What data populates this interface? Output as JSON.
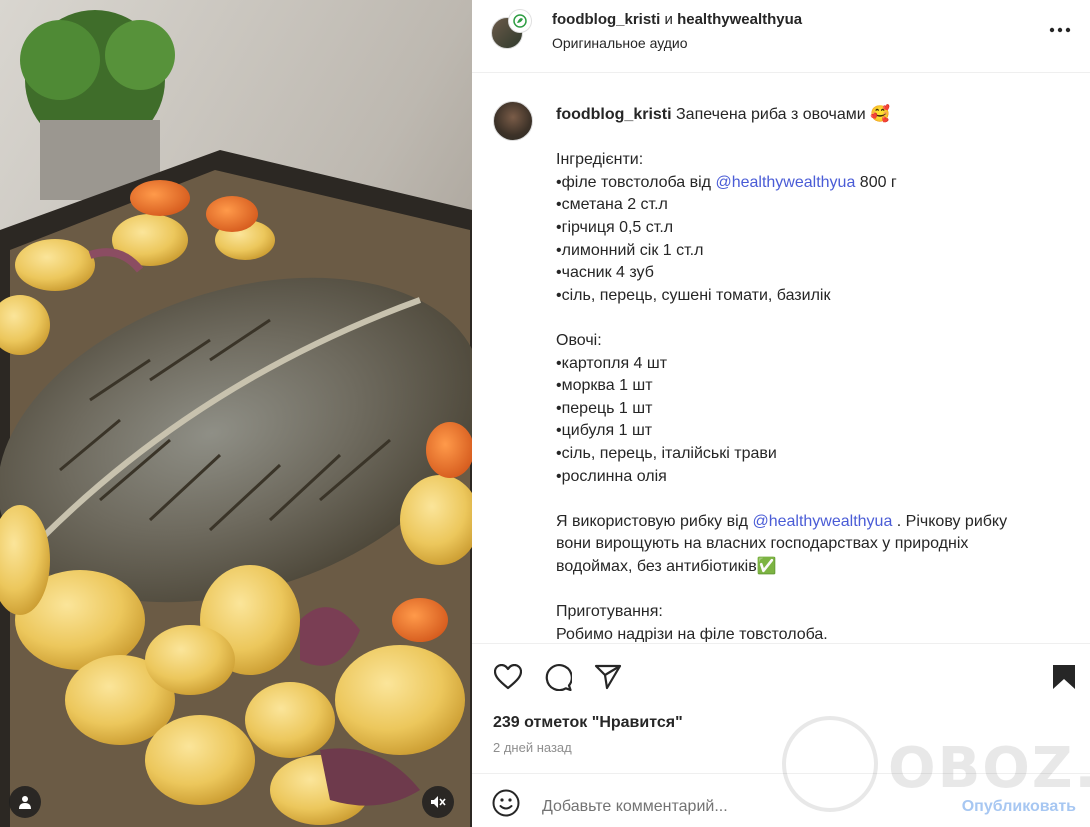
{
  "post": {
    "header": {
      "author": "foodblog_kristi",
      "conjunction": "и",
      "coauthor": "healthywealthyua",
      "audio": "Оригинальное аудио"
    },
    "caption": {
      "author": "foodblog_kristi",
      "title": "Запечена риба з овочами 🥰",
      "ingredients_heading": "Інгредієнти:",
      "ing1_prefix": "•філе товстолоба від ",
      "ing1_mention": "@healthywealthyua",
      "ing1_suffix": " 800 г",
      "ing2": "•сметана 2 ст.л",
      "ing3": "•гірчиця 0,5 ст.л",
      "ing4": "•лимонний сік 1 ст.л",
      "ing5": "•часник 4 зуб",
      "ing6": "•сіль, перець, сушені томати, базилік",
      "veg_heading": "Овочі:",
      "veg1": "•картопля 4 шт",
      "veg2": "•морква 1 шт",
      "veg3": "•перець 1 шт",
      "veg4": "•цибуля 1 шт",
      "veg5": "•сіль, перець, італійські трави",
      "veg6": "•рослинна олія",
      "para_prefix": "Я використовую рибку від ",
      "para_mention": "@healthywealthyua",
      "para_line1_suffix": " . Річкову рибку",
      "para_line2": "вони вирощують на власних господарствах у природніх",
      "para_line3": "водоймах, без антибіотиків✅",
      "prep_heading": "Приготування:",
      "prep1": "Робимо надрізи на філе товстолоба."
    },
    "actions": {
      "like_icon": "heart-icon",
      "comment_icon": "comment-icon",
      "share_icon": "paper-plane-icon",
      "save_icon": "bookmark-icon",
      "likes": "239 отметок \"Нравится\"",
      "date": "2 дней назад"
    },
    "comment": {
      "emoji_icon": "smiley-icon",
      "placeholder": "Добавьте комментарий...",
      "post_label": "Опубликовать"
    },
    "media": {
      "user_tag_icon": "user-icon",
      "mute_icon": "muted-speaker-icon"
    },
    "watermark": "OBOZ.UA",
    "colors": {
      "mention": "#4a5cd6",
      "post_button_disabled": "#a7c7f2",
      "muted_text": "#8e8e8e"
    }
  }
}
